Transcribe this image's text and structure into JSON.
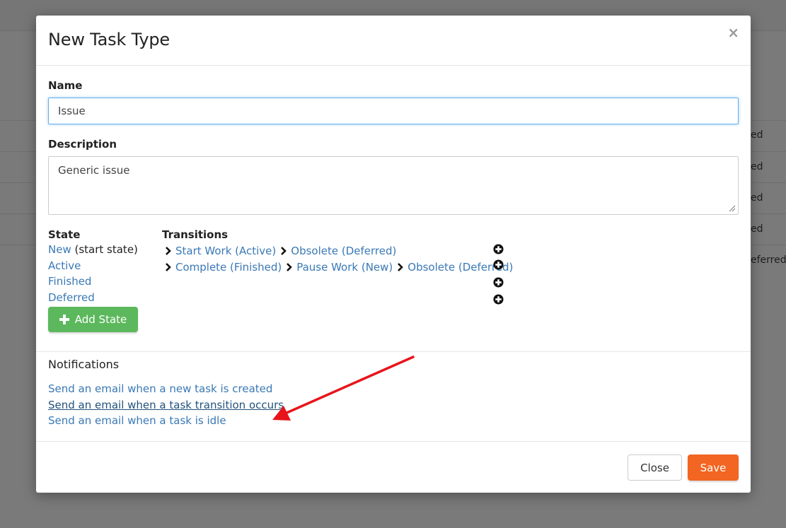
{
  "background": {
    "row_cells": [
      "ed",
      "ed",
      "ed",
      "ed",
      "eferred"
    ]
  },
  "modal": {
    "title": "New Task Type",
    "close_icon": "×"
  },
  "form": {
    "name_label": "Name",
    "name_value": "Issue",
    "description_label": "Description",
    "description_value": "Generic issue"
  },
  "states": {
    "header": "State",
    "items": [
      {
        "name": "New",
        "suffix": " (start state)"
      },
      {
        "name": "Active",
        "suffix": ""
      },
      {
        "name": "Finished",
        "suffix": ""
      },
      {
        "name": "Deferred",
        "suffix": ""
      }
    ],
    "add_button_label": "Add State"
  },
  "transitions": {
    "header": "Transitions",
    "rows": [
      [
        "Start Work (Active)",
        "Obsolete (Deferred)"
      ],
      [
        "Complete (Finished)",
        "Pause Work (New)",
        "Obsolete (Deferred)"
      ],
      [],
      []
    ]
  },
  "notifications": {
    "title": "Notifications",
    "items": [
      "Send an email when a new task is created",
      "Send an email when a task transition occurs",
      "Send an email when a task is idle"
    ]
  },
  "footer": {
    "close_label": "Close",
    "save_label": "Save"
  },
  "colors": {
    "link": "#3a79b5",
    "add_button": "#5cb85c",
    "save_button": "#f26522",
    "annotation_arrow": "#e8141b"
  }
}
